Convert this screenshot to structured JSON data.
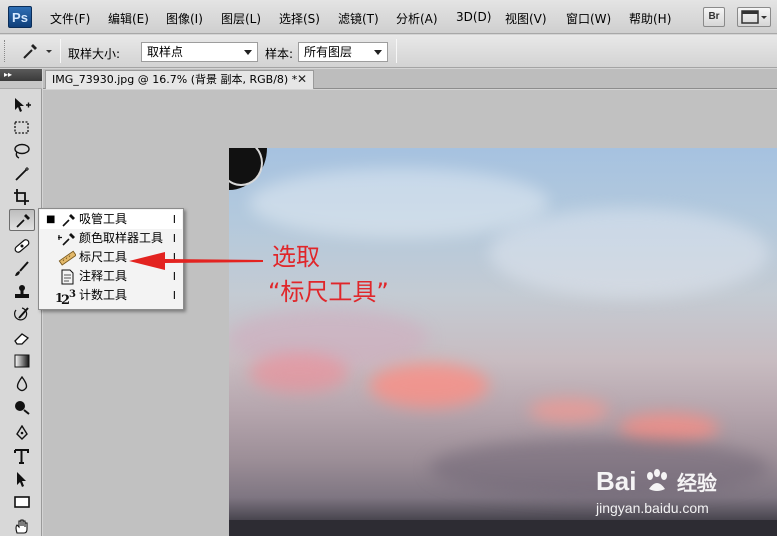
{
  "app": {
    "logo": "Ps"
  },
  "menubar": {
    "items": [
      "文件(F)",
      "编辑(E)",
      "图像(I)",
      "图层(L)",
      "选择(S)",
      "滤镜(T)",
      "分析(A)",
      "3D(D)",
      "视图(V)",
      "窗口(W)",
      "帮助(H)"
    ],
    "bridge_label": "Br"
  },
  "options": {
    "sample_size_label": "取样大小:",
    "sample_size_value": "取样点",
    "sample_label": "样本:",
    "sample_value": "所有图层"
  },
  "toolpanel": {
    "header": "▸▸"
  },
  "document": {
    "tab_title": "IMG_73930.jpg @ 16.7% (背景 副本, RGB/8) *",
    "close": "✕"
  },
  "flyout": {
    "items": [
      {
        "label": "吸管工具",
        "shortcut": "I",
        "current": true,
        "icon": "eyedropper-icon"
      },
      {
        "label": "颜色取样器工具",
        "shortcut": "I",
        "current": false,
        "icon": "color-sampler-icon"
      },
      {
        "label": "标尺工具",
        "shortcut": "I",
        "current": false,
        "icon": "ruler-icon"
      },
      {
        "label": "注释工具",
        "shortcut": "I",
        "current": false,
        "icon": "note-icon"
      },
      {
        "label": "计数工具",
        "shortcut": "I",
        "current": false,
        "icon": "count-icon"
      }
    ],
    "bullet": "■"
  },
  "annotation": {
    "line1": "选取",
    "line2": "“标尺工具”",
    "color": "#e0262a"
  },
  "watermark": {
    "brand_left": "Bai",
    "brand_right": "经验",
    "url": "jingyan.baidu.com"
  }
}
